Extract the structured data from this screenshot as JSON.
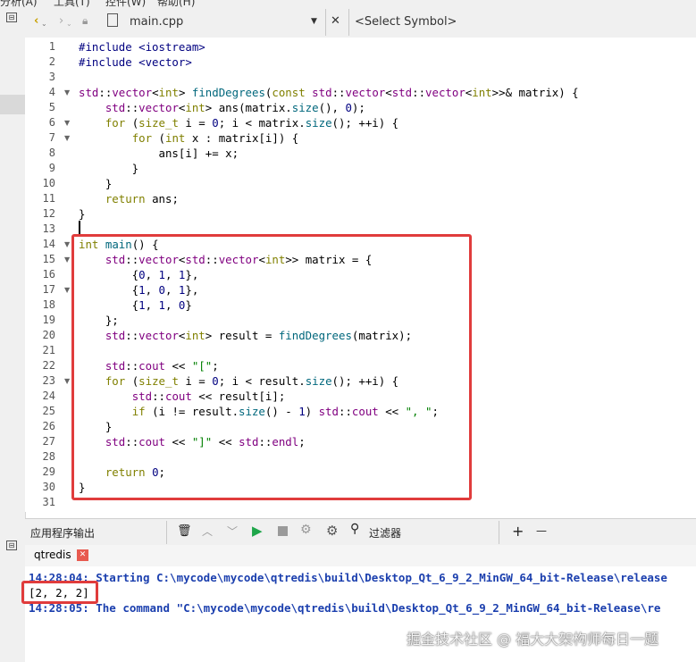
{
  "menubar": {
    "items": [
      "分析(A)",
      "工具(T)",
      "控件(W)",
      "帮助(H)"
    ]
  },
  "toolbar": {
    "file_name": "main.cpp",
    "symbol_placeholder": "<Select Symbol>",
    "close_glyph": "✕"
  },
  "editor": {
    "line_numbers": [
      "1",
      "2",
      "3",
      "4",
      "5",
      "6",
      "7",
      "8",
      "9",
      "10",
      "11",
      "12",
      "13",
      "14",
      "15",
      "16",
      "17",
      "18",
      "19",
      "20",
      "21",
      "22",
      "23",
      "24",
      "25",
      "26",
      "27",
      "28",
      "29",
      "30",
      "31"
    ],
    "lines": [
      "#include <iostream>",
      "#include <vector>",
      "",
      "std::vector<int> findDegrees(const std::vector<std::vector<int>>& matrix) {",
      "    std::vector<int> ans(matrix.size(), 0);",
      "    for (size_t i = 0; i < matrix.size(); ++i) {",
      "        for (int x : matrix[i]) {",
      "            ans[i] += x;",
      "        }",
      "    }",
      "    return ans;",
      "}",
      "",
      "int main() {",
      "    std::vector<std::vector<int>> matrix = {",
      "        {0, 1, 1},",
      "        {1, 0, 1},",
      "        {1, 1, 0}",
      "    };",
      "    std::vector<int> result = findDegrees(matrix);",
      "",
      "    std::cout << \"[\";",
      "    for (size_t i = 0; i < result.size(); ++i) {",
      "        std::cout << result[i];",
      "        if (i != result.size() - 1) std::cout << \", \";",
      "    }",
      "    std::cout << \"]\" << std::endl;",
      "",
      "    return 0;",
      "}",
      ""
    ]
  },
  "output_panel": {
    "title": "应用程序输出",
    "filter_label": "过滤器",
    "plus": "+",
    "minus": "—",
    "tab_label": "qtredis",
    "line1_time": "14:28:04:",
    "line1_text": " Starting C:\\mycode\\mycode\\qtredis\\build\\Desktop_Qt_6_9_2_MinGW_64_bit-Release\\release",
    "line2": "[2, 2, 2]",
    "line3_time": "14:28:05:",
    "line3_text": " The command \"C:\\mycode\\mycode\\qtredis\\build\\Desktop_Qt_6_9_2_MinGW_64_bit-Release\\re"
  },
  "watermark": "掘金技术社区 @ 福大大架构师每日一题",
  "colors": {
    "highlight": "#e03c3c",
    "output_blue": "#1b3fae",
    "keyword": "#808000",
    "type": "#800080"
  }
}
